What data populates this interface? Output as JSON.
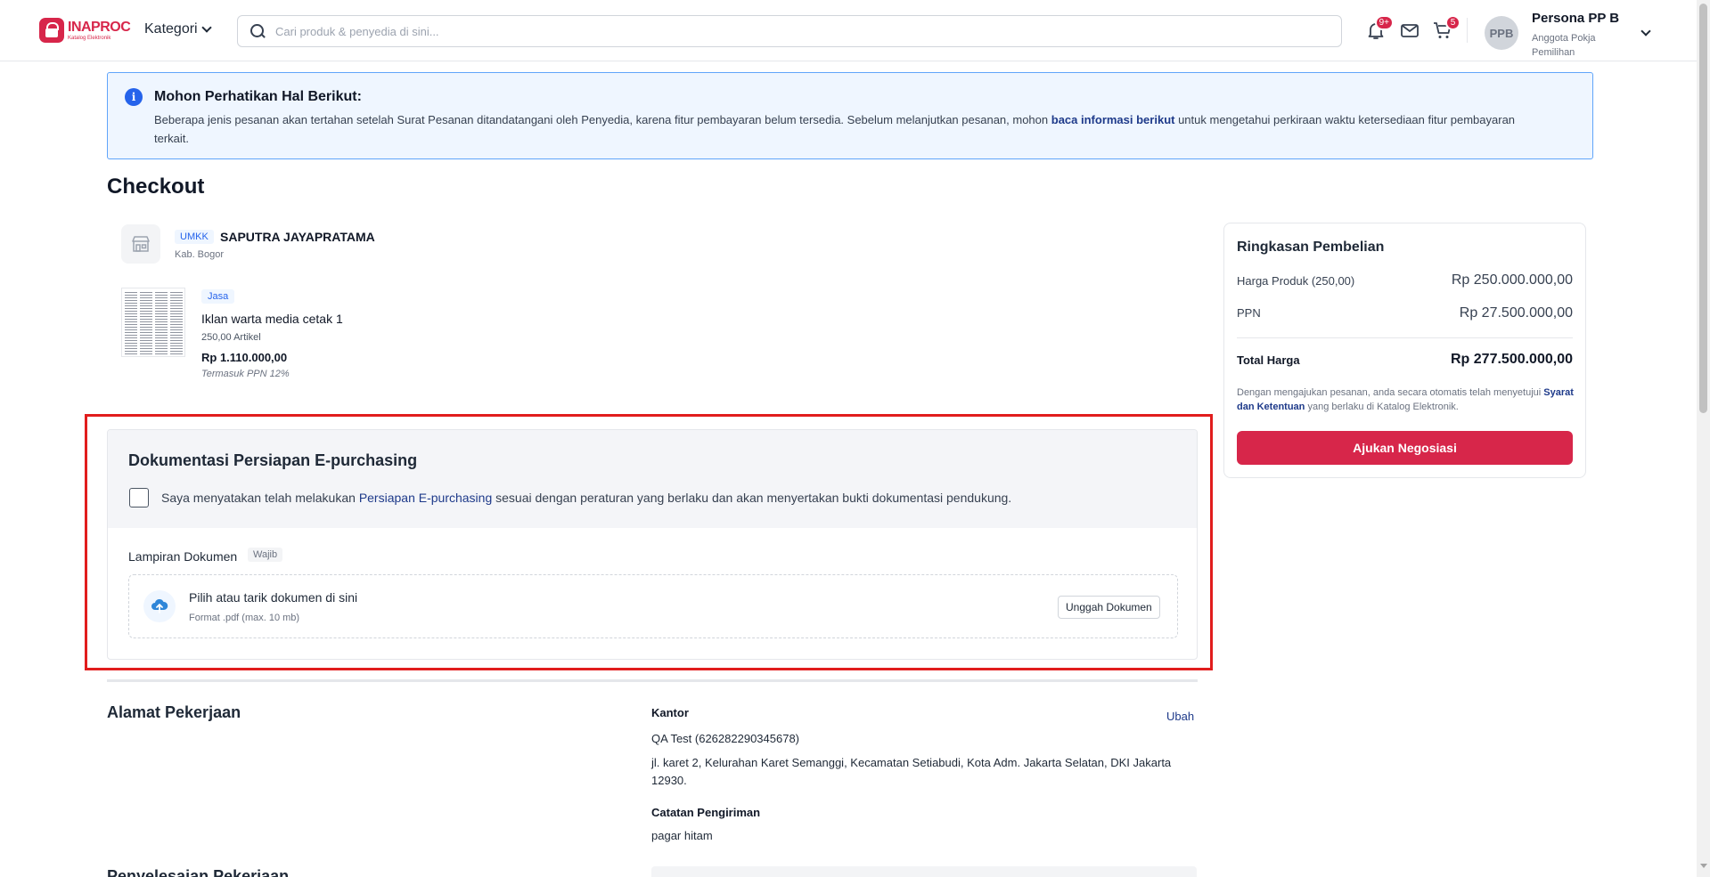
{
  "header": {
    "logo_main": "INAPROC",
    "logo_sub": "Katalog Elektronik",
    "kategori_label": "Kategori",
    "search_placeholder": "Cari produk & penyedia di sini...",
    "notification_badge": "9+",
    "cart_badge": "5",
    "user": {
      "initials": "PPB",
      "name": "Persona PP B",
      "role": "Anggota Pokja Pemilihan"
    },
    "accent_color": "#d7264a"
  },
  "notice": {
    "title": "Mohon Perhatikan Hal Berikut:",
    "body_before": "Beberapa jenis pesanan akan tertahan setelah Surat Pesanan ditandatangani oleh Penyedia, karena fitur pembayaran belum tersedia. Sebelum melanjutkan pesanan, mohon ",
    "link": "baca informasi berikut",
    "body_after": " untuk mengetahui perkiraan waktu ketersediaan fitur pembayaran terkait."
  },
  "page_title": "Checkout",
  "seller": {
    "tag": "UMKK",
    "name": "SAPUTRA JAYAPRATAMA",
    "location": "Kab. Bogor"
  },
  "product": {
    "tag": "Jasa",
    "name": "Iklan warta media cetak 1",
    "quantity": "250,00 Artikel",
    "price": "Rp 1.110.000,00",
    "tax_note": "Termasuk PPN 12%"
  },
  "documentation": {
    "title": "Dokumentasi Persiapan E-purchasing",
    "checked": false,
    "statement_before": "Saya menyatakan telah melakukan ",
    "statement_link": "Persiapan E-purchasing",
    "statement_after": " sesuai dengan peraturan yang berlaku dan akan menyertakan bukti dokumentasi pendukung.",
    "attachment_label": "Lampiran Dokumen",
    "required_tag": "Wajib",
    "dropzone_title": "Pilih atau tarik dokumen di sini",
    "dropzone_hint": "Format .pdf (max. 10 mb)",
    "upload_button": "Unggah Dokumen"
  },
  "address": {
    "section_title": "Alamat Pekerjaan",
    "label": "Kantor",
    "edit_link": "Ubah",
    "contact": "QA Test (626282290345678)",
    "full_address": "jl. karet 2, Kelurahan Karet Semanggi, Kecamatan Setiabudi, Kota Adm. Jakarta Selatan, DKI Jakarta 12930.",
    "notes_label": "Catatan Pengiriman",
    "notes": "pagar hitam"
  },
  "next_section_title": "Penyelesaian Pekerjaan",
  "summary": {
    "title": "Ringkasan Pembelian",
    "product_label": "Harga Produk (250,00)",
    "product_value": "Rp 250.000.000,00",
    "tax_label": "PPN",
    "tax_value": "Rp 27.500.000,00",
    "total_label": "Total Harga",
    "total_value": "Rp 277.500.000,00",
    "note_before": "Dengan mengajukan pesanan, anda secara otomatis telah menyetujui ",
    "note_link": "Syarat dan Ketentuan",
    "note_after": " yang berlaku di Katalog Elektronik.",
    "submit_button": "Ajukan Negosiasi"
  }
}
